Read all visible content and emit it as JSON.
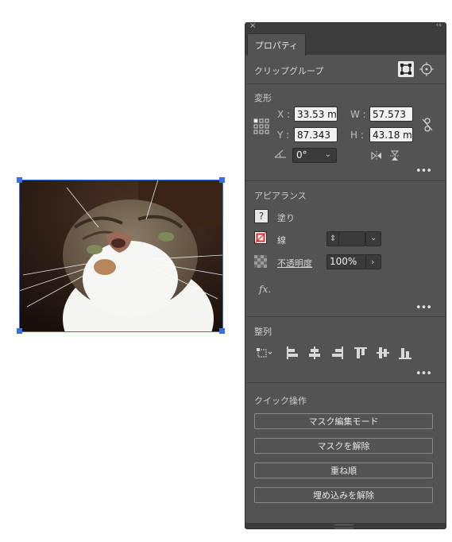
{
  "panel": {
    "close_glyph": "×",
    "collapse_glyph": "‹‹",
    "tab_label": "プロパティ",
    "object_type": "クリップグループ"
  },
  "transform": {
    "title": "変形",
    "x_label": "X :",
    "x_value": "33.53 m",
    "y_label": "Y :",
    "y_value": "87.343",
    "w_label": "W :",
    "w_value": "57.573",
    "h_label": "H :",
    "h_value": "43.18 m",
    "angle_value": "0°"
  },
  "appearance": {
    "title": "アピアランス",
    "fill_label": "塗り",
    "fill_icon_glyph": "?",
    "stroke_label": "線",
    "opacity_label": "不透明度",
    "opacity_value": "100%",
    "fx_label": "fx."
  },
  "align": {
    "title": "整列"
  },
  "quick_actions": {
    "title": "クイック操作",
    "buttons": [
      "マスク編集モード",
      "マスクを解除",
      "重ね順",
      "埋め込みを解除"
    ]
  },
  "colors": {
    "panel_bg": "#535353",
    "selection_blue": "#3a6ee6"
  }
}
